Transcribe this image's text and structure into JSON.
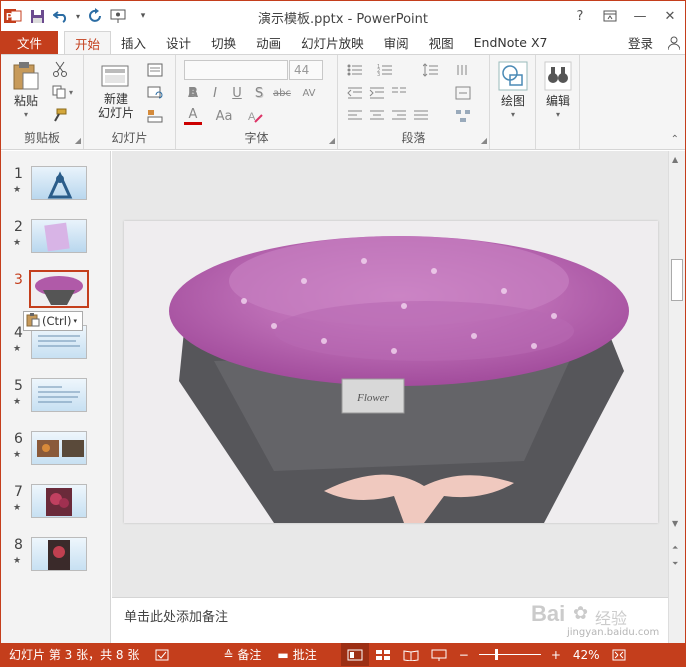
{
  "window": {
    "title": "演示模板.pptx - PowerPoint",
    "help": "?",
    "ribbon_toggle": "▭",
    "minimize": "—",
    "close": "✕"
  },
  "quick_access": [
    "powerpoint-logo-icon",
    "save-icon",
    "undo-icon",
    "redo-icon",
    "start-from-beginning-icon",
    "customize-icon"
  ],
  "tabs": [
    {
      "label": "文件",
      "active": false
    },
    {
      "label": "开始",
      "active": true
    },
    {
      "label": "插入",
      "active": false
    },
    {
      "label": "设计",
      "active": false
    },
    {
      "label": "切换",
      "active": false
    },
    {
      "label": "动画",
      "active": false
    },
    {
      "label": "幻灯片放映",
      "active": false
    },
    {
      "label": "审阅",
      "active": false
    },
    {
      "label": "视图",
      "active": false
    },
    {
      "label": "EndNote X7",
      "active": false
    },
    {
      "label": "登录",
      "active": false
    }
  ],
  "ribbon": {
    "clipboard": {
      "label": "剪贴板",
      "paste": "粘贴"
    },
    "slides": {
      "label": "幻灯片",
      "new_slide_line1": "新建",
      "new_slide_line2": "幻灯片"
    },
    "font": {
      "label": "字体",
      "font_name": "",
      "font_size": "44",
      "bold": "B",
      "italic": "I",
      "underline": "U",
      "shadow": "S",
      "strike": "abc",
      "spacing": "AV",
      "font_color": "A",
      "change_case": "Aa"
    },
    "paragraph": {
      "label": "段落"
    },
    "drawing": {
      "label": "绘图"
    },
    "editing": {
      "label": "编辑"
    }
  },
  "thumbnails": [
    {
      "num": "1",
      "star": "★",
      "selected": false
    },
    {
      "num": "2",
      "star": "★",
      "selected": false
    },
    {
      "num": "3",
      "star": "★",
      "selected": true
    },
    {
      "num": "4",
      "star": "★",
      "selected": false
    },
    {
      "num": "5",
      "star": "★",
      "selected": false
    },
    {
      "num": "6",
      "star": "★",
      "selected": false
    },
    {
      "num": "7",
      "star": "★",
      "selected": false
    },
    {
      "num": "8",
      "star": "★",
      "selected": false
    }
  ],
  "paste_options": "(Ctrl)",
  "slide": {
    "tag_text": "Flower"
  },
  "notes": {
    "placeholder": "单击此处添加备注"
  },
  "status": {
    "slide_info": "幻灯片 第 3 张，共 8 张",
    "notes": "备注",
    "comments": "批注",
    "zoom": "42%"
  },
  "watermark": {
    "brand": "Bai",
    "brand2": "经验",
    "url": "jingyan.baidu.com"
  },
  "colors": {
    "accent": "#c43e1c",
    "ribbon_bg": "#f5f5f5",
    "edit_bg": "#e8e8e8"
  }
}
